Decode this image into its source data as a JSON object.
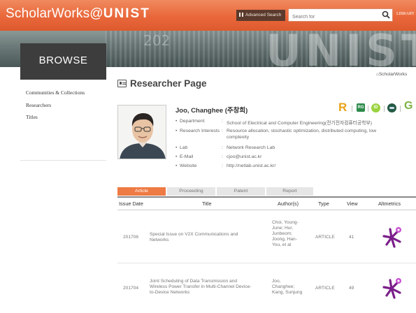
{
  "header": {
    "brand_prefix": "ScholarWorks@",
    "brand_suffix": "UNIST",
    "advanced_search": "Advanced Search",
    "search_placeholder": "Search for",
    "library": "LIBRARY",
    "accent_color": "#e9673a"
  },
  "banner": {
    "number_text": "202",
    "letters": "UNIST"
  },
  "browse": {
    "title": "BROWSE"
  },
  "sidebar": {
    "items": [
      {
        "label": "Communities & Collections"
      },
      {
        "label": "Researchers"
      },
      {
        "label": "Titles"
      }
    ]
  },
  "breadcrumb": "ScholarWorks",
  "page": {
    "title": "Researcher Page"
  },
  "researcher": {
    "name": "Joo, Changhee (주창희)",
    "fields": [
      {
        "label": "Department",
        "value": "School of Electrical and Computer Engineering(전기전자컴퓨터공학부)"
      },
      {
        "label": "Research Interests",
        "value": "Resource allocation, stochastic optimization, distributed computing, low",
        "value2": "complexity"
      },
      {
        "label": "Lab",
        "value": "Network Research Lab"
      },
      {
        "label": "E-Mail",
        "value": "cjoo@unist.ac.kr"
      },
      {
        "label": "Website",
        "value": "http://netlab.unist.ac.kr/"
      }
    ]
  },
  "metric_icons": [
    "R",
    "RG",
    "iD",
    "Scopus",
    "G"
  ],
  "tabs": [
    {
      "label": "Article",
      "active": true
    },
    {
      "label": "Proceeding",
      "active": false
    },
    {
      "label": "Patent",
      "active": false
    },
    {
      "label": "Report",
      "active": false
    }
  ],
  "table": {
    "headers": [
      "Issue Date",
      "Title",
      "Author(s)",
      "Type",
      "View",
      "Altmetrics"
    ],
    "rows": [
      {
        "date": "201706",
        "title": [
          "Special Issue on V2X Communications and",
          "Networks"
        ],
        "authors": [
          "Choi, Young-",
          "June; Hur,",
          "Junbeom;",
          "Joong, Han-",
          "You, et al"
        ],
        "type": "ARTICLE",
        "view": "41"
      },
      {
        "date": "201704",
        "title": [
          "Joint Scheduling of Data Transmission and",
          "Wireless Power Transfer in Multi-Channel Device-",
          "to-Device Networks"
        ],
        "authors": [
          "Joo,",
          "Changhee;",
          "Kang, Sunjung"
        ],
        "type": "ARTICLE",
        "view": "49"
      }
    ]
  }
}
